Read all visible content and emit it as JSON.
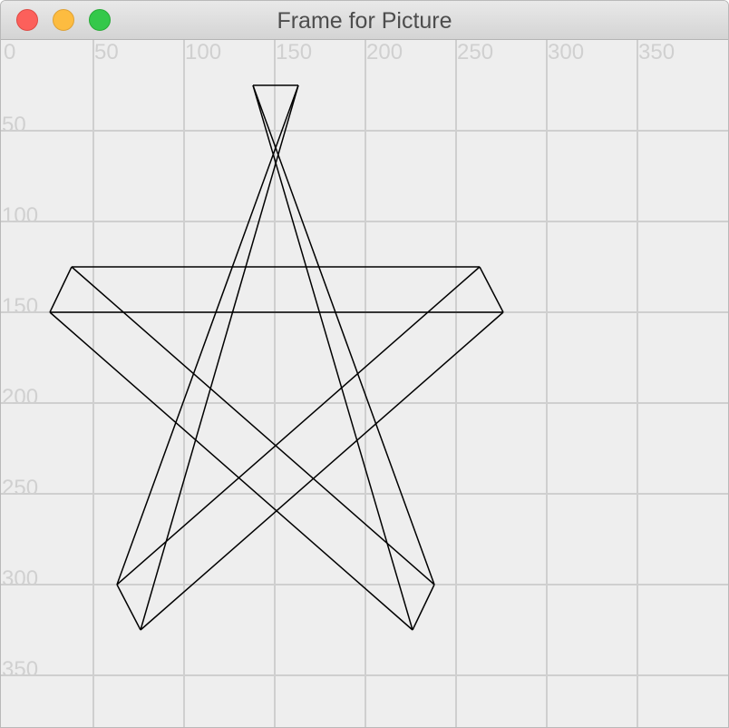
{
  "window": {
    "title": "Frame for Picture",
    "buttons": {
      "close": "close",
      "minimize": "minimize",
      "zoom": "zoom"
    }
  },
  "grid": {
    "x_labels": [
      "0",
      "50",
      "100",
      "150",
      "200",
      "250",
      "300",
      "350"
    ],
    "y_labels": [
      "50",
      "100",
      "150",
      "200",
      "250",
      "300",
      "350"
    ],
    "line_color": "#cfcfcf",
    "label_color": "#d0d0d0"
  },
  "drawing": {
    "stroke_color": "#000000",
    "segments": [
      [
        [
          138,
          25
        ],
        [
          163,
          25
        ]
      ],
      [
        [
          138,
          25
        ],
        [
          226,
          325
        ]
      ],
      [
        [
          163,
          25
        ],
        [
          76,
          325
        ]
      ],
      [
        [
          38,
          125
        ],
        [
          263,
          125
        ]
      ],
      [
        [
          26,
          150
        ],
        [
          276,
          150
        ]
      ],
      [
        [
          38,
          125
        ],
        [
          26,
          150
        ]
      ],
      [
        [
          263,
          125
        ],
        [
          276,
          150
        ]
      ],
      [
        [
          38,
          125
        ],
        [
          238,
          300
        ]
      ],
      [
        [
          26,
          150
        ],
        [
          226,
          325
        ]
      ],
      [
        [
          263,
          125
        ],
        [
          63,
          300
        ]
      ],
      [
        [
          276,
          150
        ],
        [
          76,
          325
        ]
      ],
      [
        [
          163,
          25
        ],
        [
          63,
          300
        ]
      ],
      [
        [
          138,
          25
        ],
        [
          238,
          300
        ]
      ],
      [
        [
          63,
          300
        ],
        [
          76,
          325
        ]
      ],
      [
        [
          238,
          300
        ],
        [
          226,
          325
        ]
      ]
    ]
  }
}
